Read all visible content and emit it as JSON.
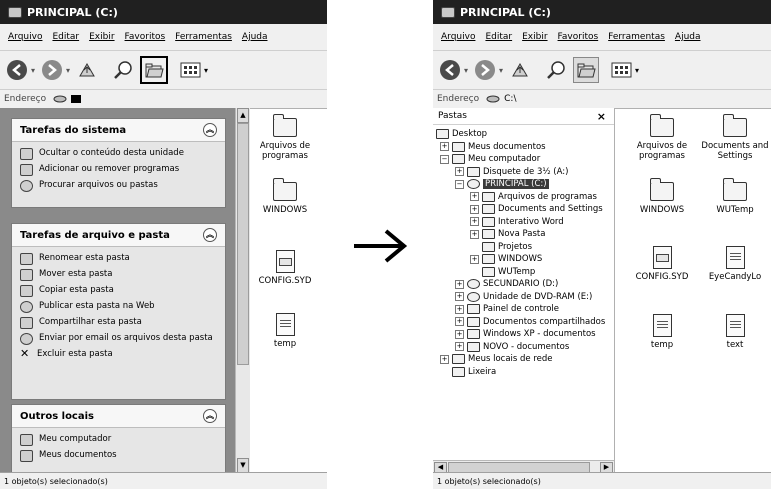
{
  "left": {
    "title": "PRINCIPAL (C:)",
    "menu": [
      "Arquivo",
      "Editar",
      "Exibir",
      "Favoritos",
      "Ferramentas",
      "Ajuda"
    ],
    "address_label": "Endereço",
    "panels": {
      "system": {
        "title": "Tarefas do sistema",
        "items": [
          "Ocultar o conteúdo desta unidade",
          "Adicionar ou remover programas",
          "Procurar arquivos ou pastas"
        ]
      },
      "file": {
        "title": "Tarefas de arquivo e pasta",
        "items": [
          "Renomear esta pasta",
          "Mover esta pasta",
          "Copiar esta pasta",
          "Publicar esta pasta na Web",
          "Compartilhar esta pasta",
          "Enviar por email os arquivos desta pasta",
          "Excluir esta pasta"
        ]
      },
      "other": {
        "title": "Outros locais",
        "items": [
          "Meu computador",
          "Meus documentos"
        ]
      }
    },
    "files": [
      "Arquivos de programas",
      "WINDOWS",
      "CONFIG.SYD",
      "temp"
    ],
    "status": "1 objeto(s) selecionado(s)"
  },
  "right": {
    "title": "PRINCIPAL (C:)",
    "menu": [
      "Arquivo",
      "Editar",
      "Exibir",
      "Favoritos",
      "Ferramentas",
      "Ajuda"
    ],
    "address_label": "Endereço",
    "address_value": "C:\\",
    "folders_label": "Pastas",
    "close_glyph": "×",
    "tree": {
      "desktop": "Desktop",
      "meus_documentos": "Meus documentos",
      "meu_computador": "Meu computador",
      "disquete": "Disquete de 3½ (A:)",
      "principal": "PRINCIPAL (C:)",
      "arquivos_programas": "Arquivos de programas",
      "documents_settings": "Documents and Settings",
      "interativo_word": "Interativo Word",
      "nova_pasta": "Nova Pasta",
      "projetos": "Projetos",
      "windows": "WINDOWS",
      "wutemp": "WUTemp",
      "secundario": "SECUNDARIO (D:)",
      "dvd": "Unidade de DVD-RAM (E:)",
      "painel": "Painel de controle",
      "docs_compartilhados": "Documentos compartilhados",
      "winxp_docs": "Windows XP - documentos",
      "novo_docs": "NOVO - documentos",
      "locais_rede": "Meus locais de rede",
      "lixeira": "Lixeira"
    },
    "files": [
      "Arquivos de programas",
      "Documents and Settings",
      "WINDOWS",
      "WUTemp",
      "CONFIG.SYD",
      "EyeCandyLo",
      "temp",
      "text"
    ],
    "status": "1 objeto(s) selecionado(s)"
  }
}
